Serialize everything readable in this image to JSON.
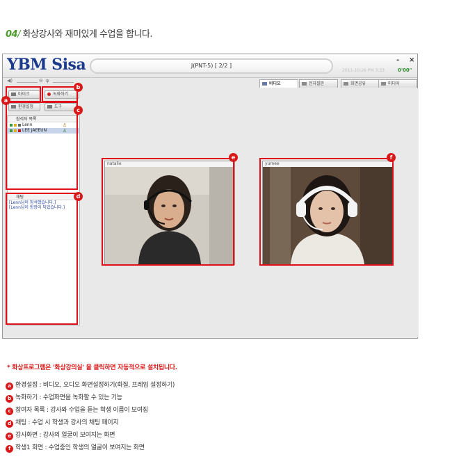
{
  "heading": {
    "number": "04",
    "slash": "/",
    "text": " 화상강사와 재미있게 수업을 합니다."
  },
  "app": {
    "logo": "YBM Sisa",
    "window_title": "J(PNT-5) [ 2/2 ]",
    "minimize": "-",
    "close": "×",
    "datetime": "2011-10-26 PM 3:33",
    "timer": "0'00\"",
    "tabs": [
      {
        "label": "비디오",
        "active": true
      },
      {
        "label": "전자칠판",
        "active": false
      },
      {
        "label": "화면공유",
        "active": false
      },
      {
        "label": "미디어",
        "active": false
      }
    ],
    "buttons": {
      "mic": "마이크",
      "record": "녹화하기",
      "settings": "환경설정",
      "tools": "도구"
    },
    "participants": {
      "title": "참석자 목록",
      "list": [
        {
          "name": "Lenn",
          "selected": false
        },
        {
          "name": "LEE JAEEUN",
          "selected": true
        }
      ]
    },
    "chat": {
      "title": "채팅",
      "messages": [
        "[Lenn님이 참석했습니다.]",
        "[Lenn님이 방장이 되었습니다.]"
      ]
    },
    "videos": {
      "teacher_name": "natalie",
      "student_name": "yumee"
    }
  },
  "badges": {
    "a": "a",
    "b": "b",
    "c": "c",
    "d": "d",
    "e": "e",
    "f": "f"
  },
  "notice": "* 화상프로그램은 '화상강의실' 을 클릭하면 자동적으로 설치됩니다.",
  "legend": [
    {
      "badge": "a",
      "text": "환경설정 : 비디오, 오디오 화면설정하기(화질, 프레임 설정하기)"
    },
    {
      "badge": "b",
      "text": "녹화하기 : 수업화면을 녹화할 수 있는 기능"
    },
    {
      "badge": "c",
      "text": "참여자 목록 : 강사와 수업을 듣는 학생 이름이 보여짐"
    },
    {
      "badge": "d",
      "text": "채팅 : 수업 시 학생과 강사의 채팅 페이지"
    },
    {
      "badge": "e",
      "text": "강사화면 : 강사의 얼굴이 보여지는 화면"
    },
    {
      "badge": "f",
      "text": "학생1 회면 : 수업중인 학생의 얼굴이 보여지는 화면"
    }
  ],
  "colors": {
    "accent_red": "#d81a1a",
    "brand_blue": "#1c3a8c",
    "heading_green": "#4a9c2a"
  }
}
